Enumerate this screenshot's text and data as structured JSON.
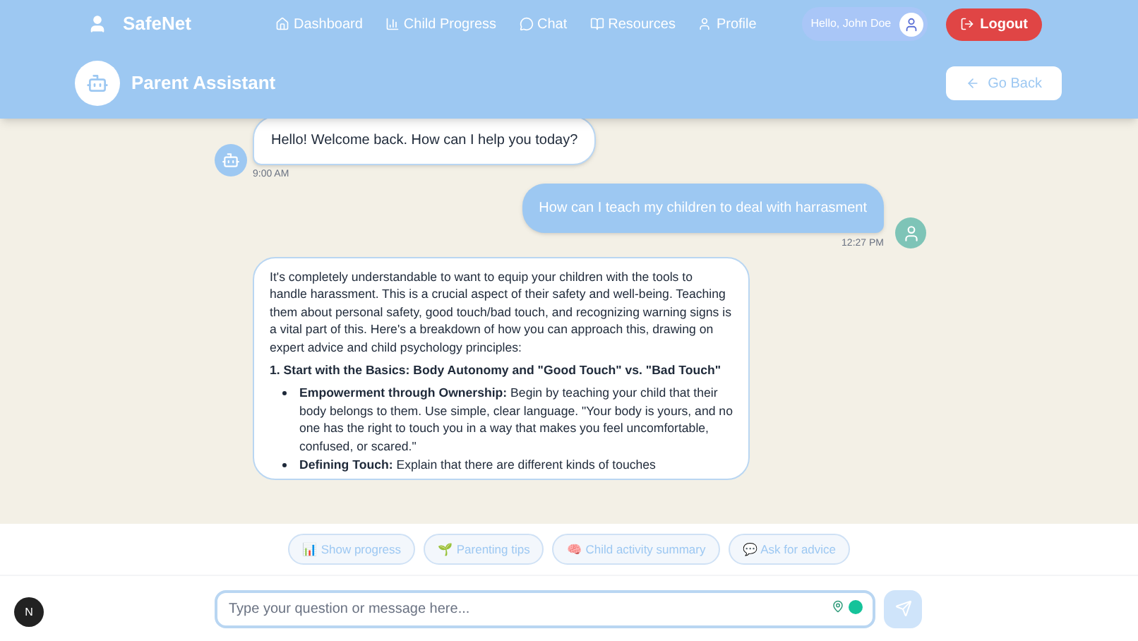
{
  "brand": "SafeNet",
  "nav": [
    {
      "label": "Dashboard"
    },
    {
      "label": "Child Progress"
    },
    {
      "label": "Chat"
    },
    {
      "label": "Resources"
    },
    {
      "label": "Profile"
    }
  ],
  "greeting": "Hello, John Doe",
  "logout": "Logout",
  "page_title": "Parent Assistant",
  "back": "Go Back",
  "messages": [
    {
      "kind": "assistant",
      "text": "Hello! Welcome back. How can I help you today?",
      "time": "9:00 AM"
    },
    {
      "kind": "user",
      "text": "How can I teach my children to deal with harrasment",
      "time": "12:27 PM"
    },
    {
      "kind": "assistant-long",
      "paragraphs": [
        {
          "kind": "p",
          "text": "It's completely understandable to want to equip your children with the tools to handle harassment. This is a crucial aspect of their safety and well-being. Teaching them about personal safety, good touch/bad touch, and recognizing warning signs is a vital part of this. Here's a breakdown of how you can approach this, drawing on expert advice and child psychology principles:"
        },
        {
          "kind": "heading",
          "text": "1. Start with the Basics: Body Autonomy and \"Good Touch\" vs. \"Bad Touch\""
        },
        {
          "kind": "bullet",
          "text": "**Empowerment through Ownership:** Begin by teaching your child that their body belongs to them. Use simple, clear language. \"Your body is yours, and no one has the right to touch you in a way that makes you feel uncomfortable, confused, or scared.\""
        },
        {
          "kind": "bullet",
          "text": "**Defining Touch:** Explain that there are different kinds of touches"
        }
      ]
    }
  ],
  "chips": [
    "📊 Show progress",
    "🌱 Parenting tips",
    "🧠 Child activity summary",
    "💬 Ask for advice"
  ],
  "input": {
    "placeholder": "Type your question or message here..."
  },
  "badge": "N"
}
